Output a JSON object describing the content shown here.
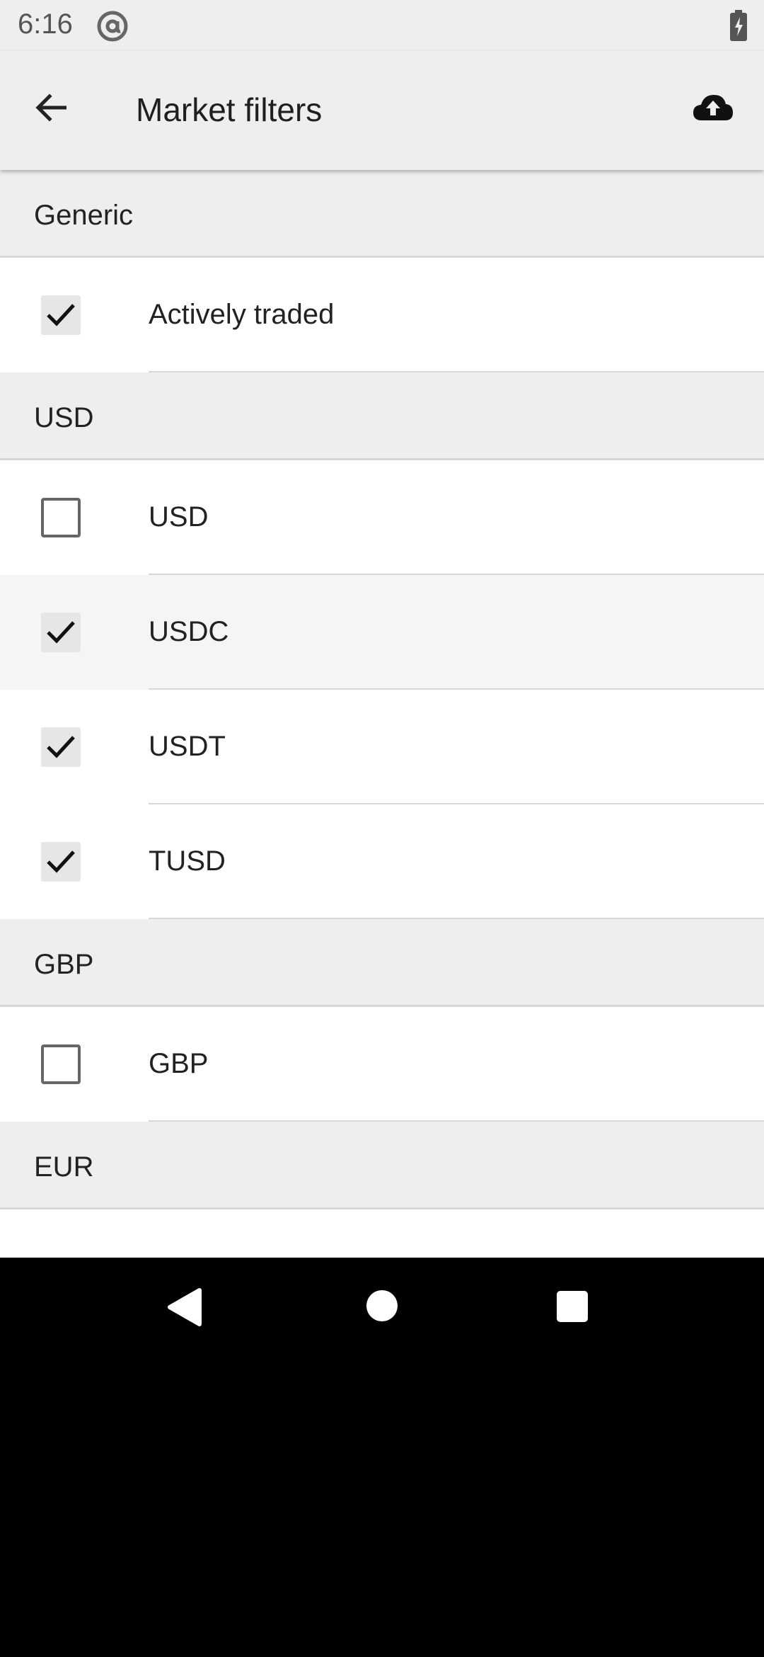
{
  "status_bar": {
    "time": "6:16",
    "notification_icon": "at-sign-icon",
    "battery_icon": "battery-charging-icon"
  },
  "app_bar": {
    "title": "Market filters",
    "back_icon": "arrow-back-icon",
    "action_icon": "cloud-upload-icon"
  },
  "sections": [
    {
      "header": "Generic",
      "items": [
        {
          "label": "Actively traded",
          "checked": true
        }
      ]
    },
    {
      "header": "USD",
      "items": [
        {
          "label": "USD",
          "checked": false
        },
        {
          "label": "USDC",
          "checked": true
        },
        {
          "label": "USDT",
          "checked": true
        },
        {
          "label": "TUSD",
          "checked": true
        }
      ]
    },
    {
      "header": "GBP",
      "items": [
        {
          "label": "GBP",
          "checked": false
        }
      ]
    },
    {
      "header": "EUR",
      "items": []
    }
  ],
  "nav_bar": {
    "back": "nav-back-icon",
    "home": "nav-home-icon",
    "recents": "nav-recents-icon"
  },
  "colors": {
    "header_bg": "#eeeeee",
    "row_bg": "#ffffff",
    "text": "#222222"
  }
}
